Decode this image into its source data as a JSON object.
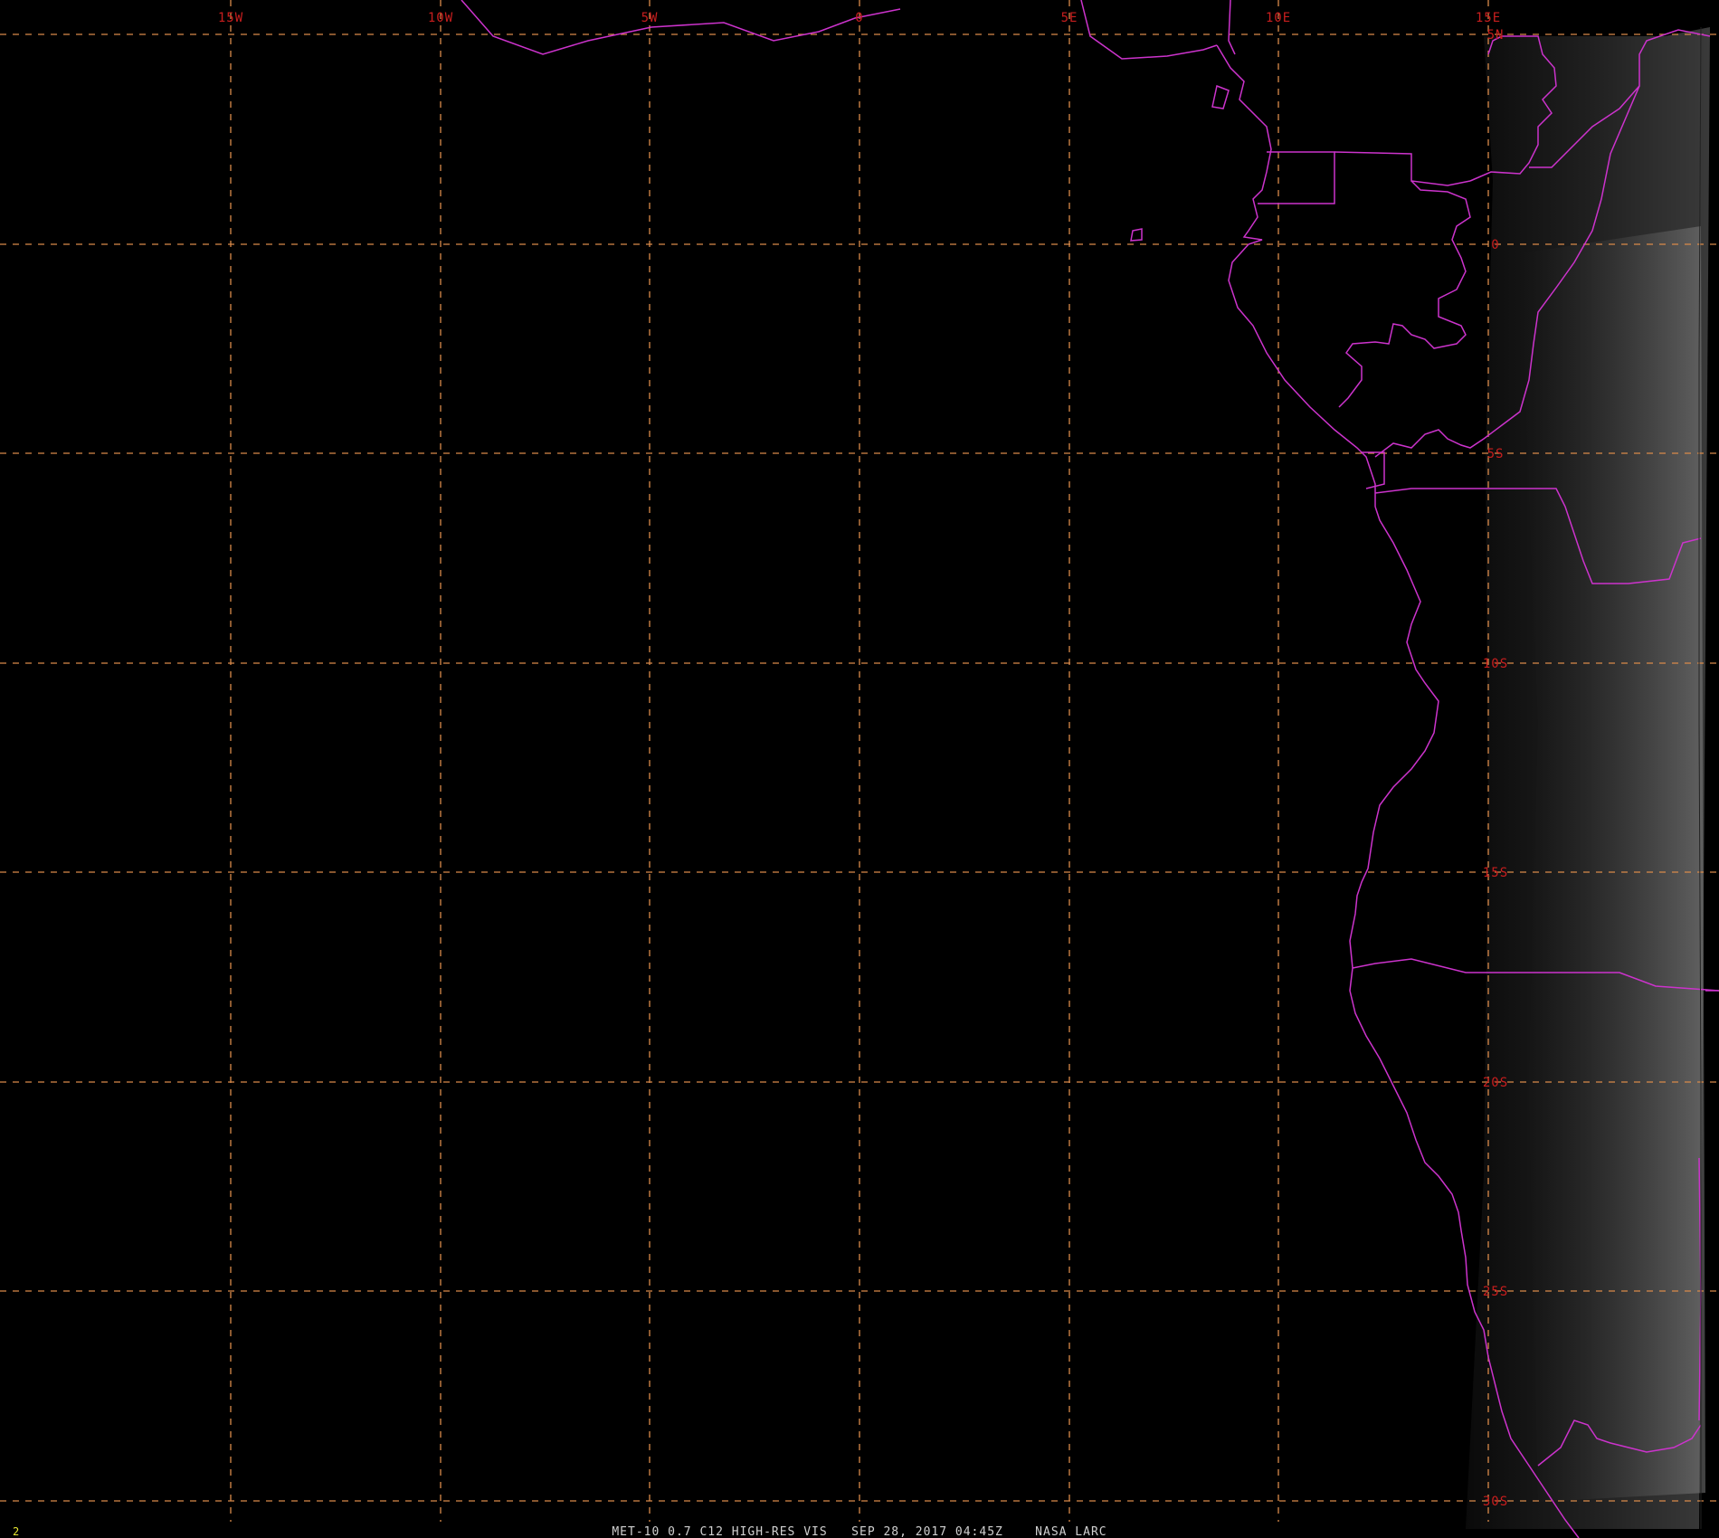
{
  "map": {
    "longitude_labels": [
      "15W",
      "10W",
      "5W",
      "0",
      "5E",
      "10E",
      "15E"
    ],
    "latitude_labels": [
      "5N",
      "0",
      "5S",
      "10S",
      "15S",
      "20S",
      "25S",
      "30S"
    ],
    "colors": {
      "background": "#000000",
      "graticule": "#d98a4a",
      "grid_label": "#c81e1e",
      "boundaries": "#cc33cc",
      "footer_text": "#d0d0d0",
      "frame_number": "#e6e632"
    }
  },
  "footer": {
    "frame_number": "2",
    "caption": "MET-10 0.7 C12 HIGH-RES VIS   SEP 28, 2017 04:45Z    NASA LARC"
  }
}
